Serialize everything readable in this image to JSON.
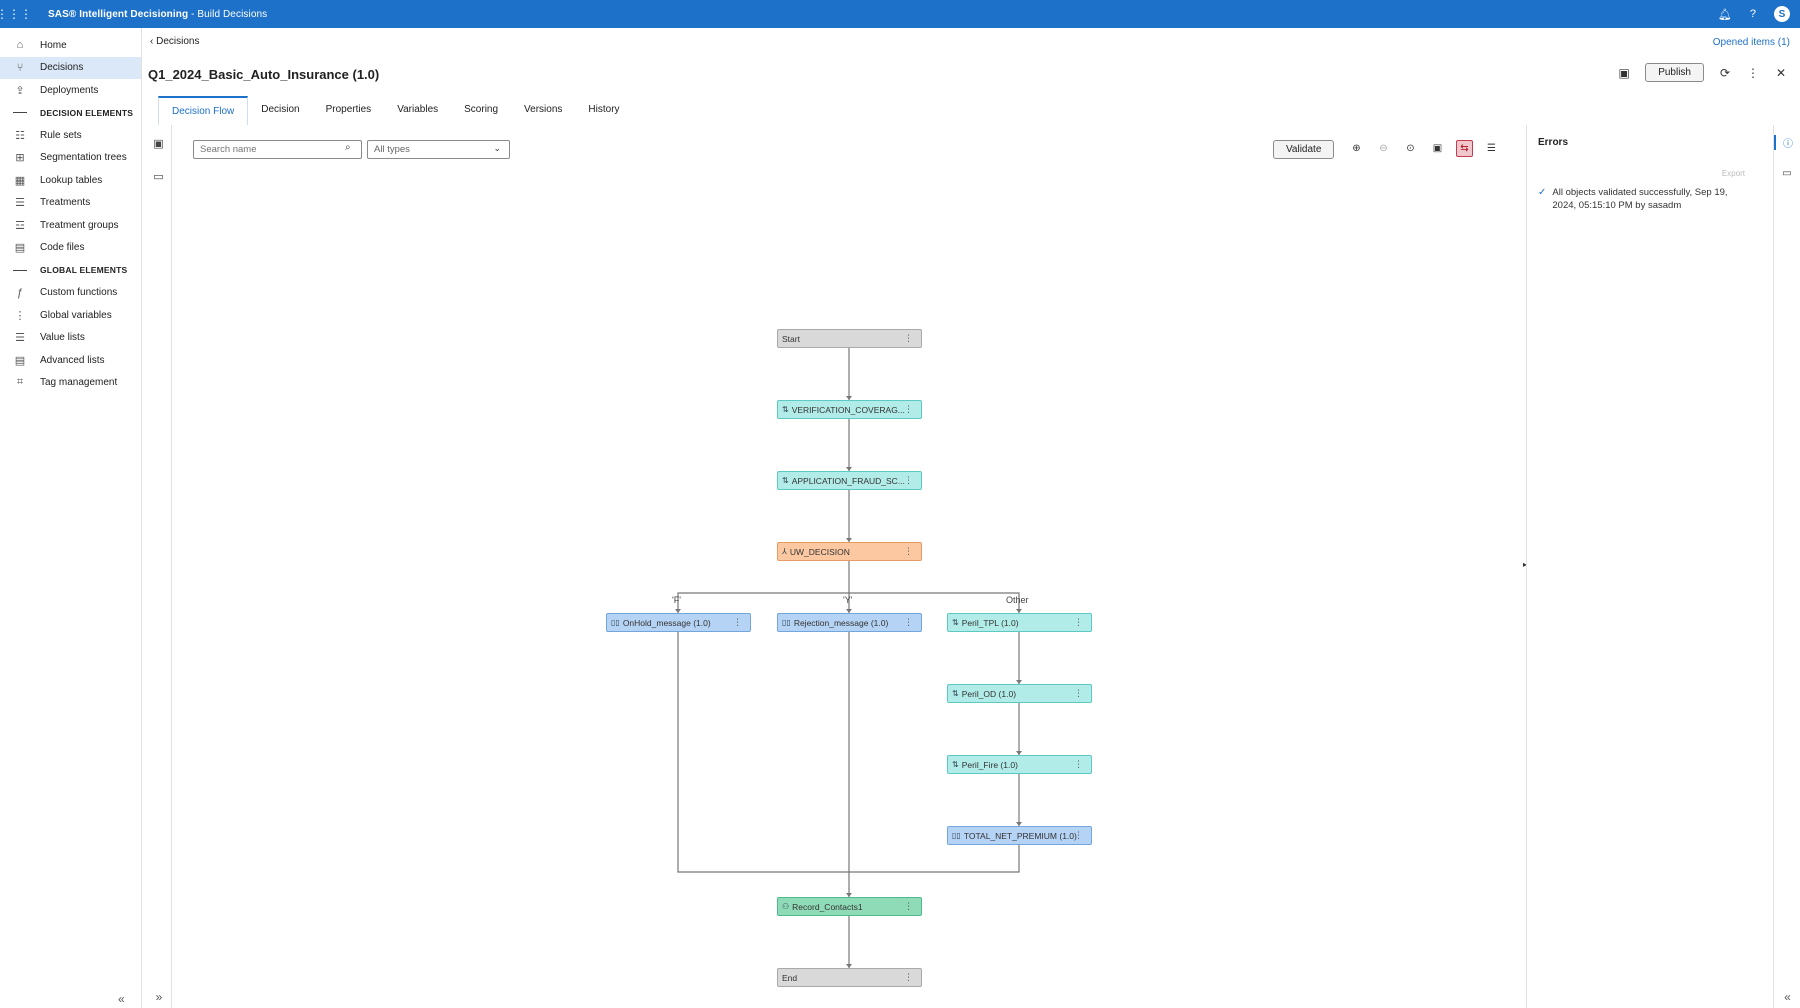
{
  "app": {
    "title": "SAS® Intelligent Decisioning",
    "subtitle": " - Build Decisions",
    "avatar": "S"
  },
  "nav": {
    "items": [
      {
        "label": "Home",
        "icon": "⌂"
      },
      {
        "label": "Decisions",
        "icon": "⑂"
      },
      {
        "label": "Deployments",
        "icon": "⇪"
      }
    ],
    "section1": "DECISION ELEMENTS",
    "items2": [
      {
        "label": "Rule sets",
        "icon": "☷"
      },
      {
        "label": "Segmentation trees",
        "icon": "⊞"
      },
      {
        "label": "Lookup tables",
        "icon": "▦"
      },
      {
        "label": "Treatments",
        "icon": "☰"
      },
      {
        "label": "Treatment groups",
        "icon": "☲"
      },
      {
        "label": "Code files",
        "icon": "▤"
      }
    ],
    "section2": "GLOBAL ELEMENTS",
    "items3": [
      {
        "label": "Custom functions",
        "icon": "ƒ"
      },
      {
        "label": "Global variables",
        "icon": "⋮"
      },
      {
        "label": "Value lists",
        "icon": "☰"
      },
      {
        "label": "Advanced lists",
        "icon": "▤"
      },
      {
        "label": "Tag management",
        "icon": "⌗"
      }
    ],
    "collapse": "«"
  },
  "header": {
    "breadcrumb": "‹  Decisions",
    "opened_items": "Opened items (1)",
    "title": "Q1_2024_Basic_Auto_Insurance (1.0)",
    "publish": "Publish"
  },
  "tabs": [
    "Decision Flow",
    "Decision",
    "Properties",
    "Variables",
    "Scoring",
    "Versions",
    "History"
  ],
  "toolbar": {
    "search_placeholder": "Search name",
    "type_select": "All types",
    "validate": "Validate",
    "expand": "»"
  },
  "flow": {
    "nodes": [
      {
        "label": "Start",
        "icon": ""
      },
      {
        "label": "VERIFICATION_COVERAG...",
        "icon": "⇅"
      },
      {
        "label": "APPLICATION_FRAUD_SC...",
        "icon": "⇅"
      },
      {
        "label": "UW_DECISION",
        "icon": "⅄"
      },
      {
        "label": "OnHold_message (1.0)",
        "icon": "▯▯"
      },
      {
        "label": "Rejection_message (1.0)",
        "icon": "▯▯"
      },
      {
        "label": "Peril_TPL (1.0)",
        "icon": "⇅"
      },
      {
        "label": "Peril_OD (1.0)",
        "icon": "⇅"
      },
      {
        "label": "Peril_Fire (1.0)",
        "icon": "⇅"
      },
      {
        "label": "TOTAL_NET_PREMIUM (1.0)",
        "icon": "▯▯"
      },
      {
        "label": "Record_Contacts1",
        "icon": "⚇"
      },
      {
        "label": "End",
        "icon": ""
      }
    ],
    "branches": [
      "'F'",
      "'Y'",
      "Other"
    ]
  },
  "errors_panel": {
    "title": "Errors",
    "export": "Export",
    "message": "All objects validated successfully, Sep 19, 2024, 05:15:10 PM by sasadm"
  },
  "rail": {
    "collapse": "«"
  }
}
